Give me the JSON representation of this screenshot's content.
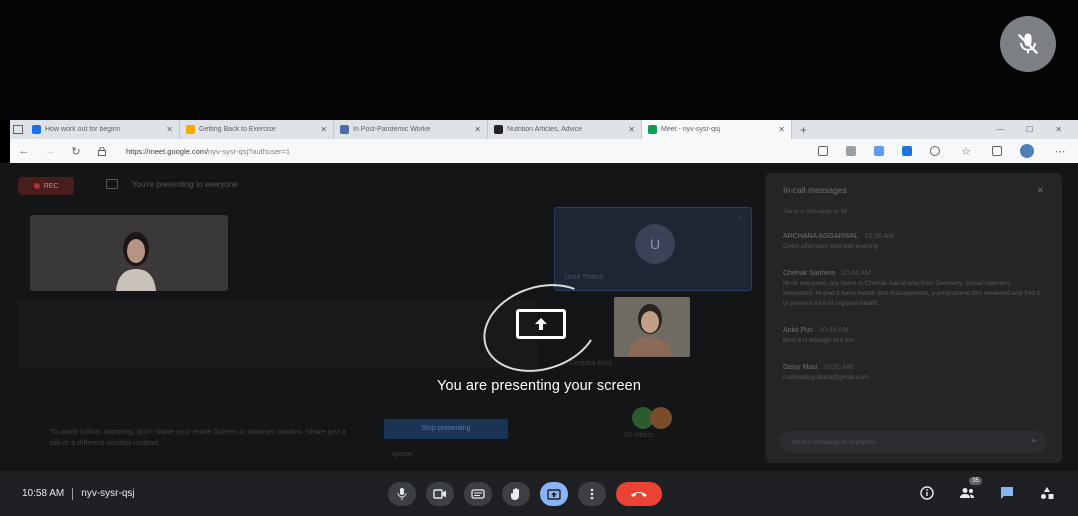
{
  "browser": {
    "tabs": [
      {
        "title": "How work out for beginn",
        "color": "#1a73e8"
      },
      {
        "title": "Getting Back to Exercise",
        "color": "#f9ab00"
      },
      {
        "title": "In Post-Pandemic Worke",
        "color": "#4a6fa5"
      },
      {
        "title": "Nutrition Articles, Advice",
        "color": "#202124"
      },
      {
        "title": "Meet - nyv-sysr-qsj",
        "color": "#0f9d58"
      }
    ],
    "url_host": "https://meet.google.com/",
    "url_path": "nyv-sysr-qsj?authuser=1"
  },
  "meet": {
    "rec_label": "REC",
    "presenting_banner": "You're presenting to everyone",
    "tip_text": "To avoid infinity mirroring, don't share your entire Screen or browser window. Share just a tab or a different window instead.",
    "stop_button": "Stop presenting",
    "ignore_label": "Ignore",
    "tile_u_initial": "U",
    "tile_u_name": "Urna Thakur",
    "tile_person_name": "Deepika Kaur",
    "tile_others_label": "33 others"
  },
  "chat": {
    "title": "In-call messages",
    "subtitle": "Send a message to all",
    "messages": [
      {
        "author": "ARCHANA AGGARWAL",
        "time": "10:26 AM",
        "text": "Good afternoon and well evening"
      },
      {
        "author": "Chehak Sanheta",
        "time": "10:44 AM",
        "text": "Hi ok everyone, my name is Chehak Aanaharta from Germany. Social manners: Interested. Hoped it turns health and management, a programme this weekend and find it to prevent a lot of regional health."
      },
      {
        "author": "Ankit Puri",
        "time": "10:46 AM",
        "text": "Best it is enough of it too"
      },
      {
        "author": "Daisy Masi",
        "time": "10:50 AM",
        "text": "malinidaisy.aleka@gmail.com"
      }
    ],
    "input_placeholder": "Send a message to everyone"
  },
  "overlay": {
    "text": "You are presenting your screen"
  },
  "bottom": {
    "time": "10:58 AM",
    "meeting_code": "nyv-sysr-qsj",
    "people_count": "35"
  },
  "colors": {
    "end_call": "#ea4335",
    "present_active": "#8ab4f8",
    "control_bg": "#3c4043",
    "bar_bg": "#1f2023"
  }
}
